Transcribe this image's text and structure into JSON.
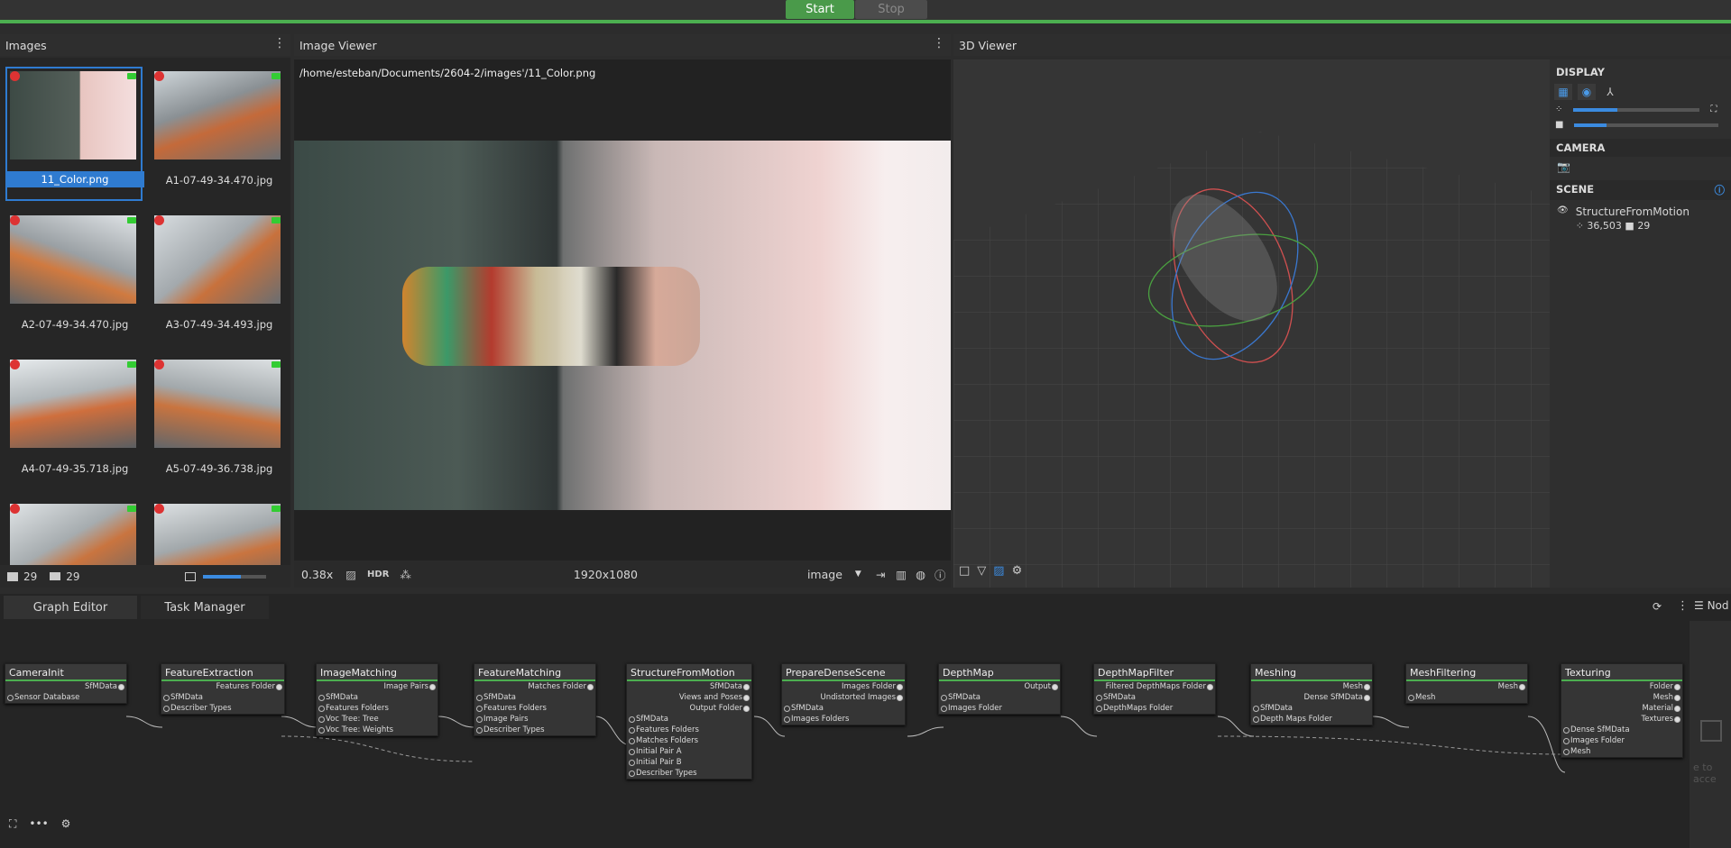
{
  "toolbar": {
    "start_label": "Start",
    "stop_label": "Stop"
  },
  "images_panel": {
    "title": "Images",
    "image_count": "29",
    "camera_count": "29",
    "thumbnails": [
      {
        "name": "11_Color.png"
      },
      {
        "name": "A1-07-49-34.470.jpg"
      },
      {
        "name": "A2-07-49-34.470.jpg"
      },
      {
        "name": "A3-07-49-34.493.jpg"
      },
      {
        "name": "A4-07-49-35.718.jpg"
      },
      {
        "name": "A5-07-49-36.738.jpg"
      },
      {
        "name": ""
      },
      {
        "name": ""
      }
    ],
    "thumb_size_level": 0.6
  },
  "image_viewer": {
    "title": "Image Viewer",
    "path": "/home/esteban/Documents/2604-2/images'/11_Color.png",
    "zoom": "0.38x",
    "hdr": "HDR",
    "resolution": "1920x1080",
    "mode": "image"
  },
  "viewer3d": {
    "title": "3D Viewer"
  },
  "side": {
    "display_label": "DISPLAY",
    "camera_label": "CAMERA",
    "scene_label": "SCENE",
    "scene_item": "StructureFromMotion",
    "points": "36,503",
    "cameras": "29",
    "point_size_level": 0.35,
    "camera_scale_level": 0.22
  },
  "graph": {
    "tabs": [
      "Graph Editor",
      "Task Manager"
    ],
    "right_label": "Nod",
    "ghost_text": "e to acce",
    "nodes": [
      {
        "title": "CameraInit",
        "inputs": [
          "Sensor Database"
        ],
        "outputs": [
          "SfMData"
        ]
      },
      {
        "title": "FeatureExtraction",
        "inputs": [
          "SfMData",
          "Describer Types"
        ],
        "outputs": [
          "Features Folder"
        ]
      },
      {
        "title": "ImageMatching",
        "inputs": [
          "SfMData",
          "Features Folders",
          "Voc Tree: Tree",
          "Voc Tree: Weights"
        ],
        "outputs": [
          "Image Pairs"
        ]
      },
      {
        "title": "FeatureMatching",
        "inputs": [
          "SfMData",
          "Features Folders",
          "Image Pairs",
          "Describer Types"
        ],
        "outputs": [
          "Matches Folder"
        ]
      },
      {
        "title": "StructureFromMotion",
        "inputs": [
          "SfMData",
          "Features Folders",
          "Matches Folders",
          "Initial Pair A",
          "Initial Pair B",
          "Describer Types"
        ],
        "outputs": [
          "SfMData",
          "Views and Poses",
          "Output Folder"
        ]
      },
      {
        "title": "PrepareDenseScene",
        "inputs": [
          "SfMData",
          "Images Folders"
        ],
        "outputs": [
          "Images Folder",
          "Undistorted Images"
        ]
      },
      {
        "title": "DepthMap",
        "inputs": [
          "SfMData",
          "Images Folder"
        ],
        "outputs": [
          "Output"
        ]
      },
      {
        "title": "DepthMapFilter",
        "inputs": [
          "SfMData",
          "DepthMaps Folder"
        ],
        "outputs": [
          "Filtered DepthMaps Folder"
        ]
      },
      {
        "title": "Meshing",
        "inputs": [
          "SfMData",
          "Depth Maps Folder"
        ],
        "outputs": [
          "Mesh",
          "Dense SfMData"
        ]
      },
      {
        "title": "MeshFiltering",
        "inputs": [
          "Mesh"
        ],
        "outputs": [
          "Mesh"
        ]
      },
      {
        "title": "Texturing",
        "inputs": [
          "Dense SfMData",
          "Images Folder",
          "Mesh"
        ],
        "outputs": [
          "Folder",
          "Mesh",
          "Material",
          "Textures"
        ]
      }
    ]
  },
  "colors": {
    "accent": "#4caf50",
    "selection": "#2f7bd0",
    "error": "#dd3333"
  }
}
